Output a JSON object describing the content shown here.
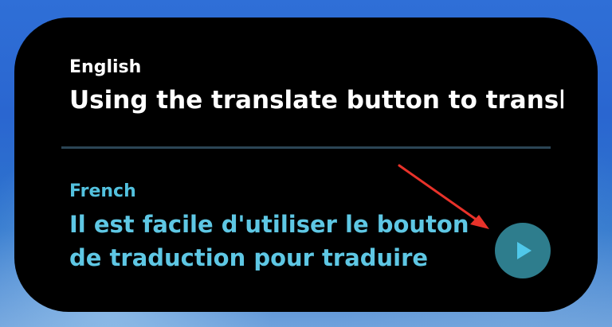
{
  "widget": {
    "source": {
      "language": "English",
      "text": "Using the translate button to transl..."
    },
    "target": {
      "language": "French",
      "text": "Il est facile d'utiliser le bouton de traduction pour traduire"
    },
    "play_button": {
      "icon": "play-icon"
    }
  },
  "colors": {
    "widget_background": "#000000",
    "source_text": "#ffffff",
    "target_text": "#5ec7e4",
    "play_button_fill": "#2e7d8d",
    "play_icon": "#50c8ea",
    "divider": "#2b4555",
    "annotation_arrow": "#e8322a"
  }
}
